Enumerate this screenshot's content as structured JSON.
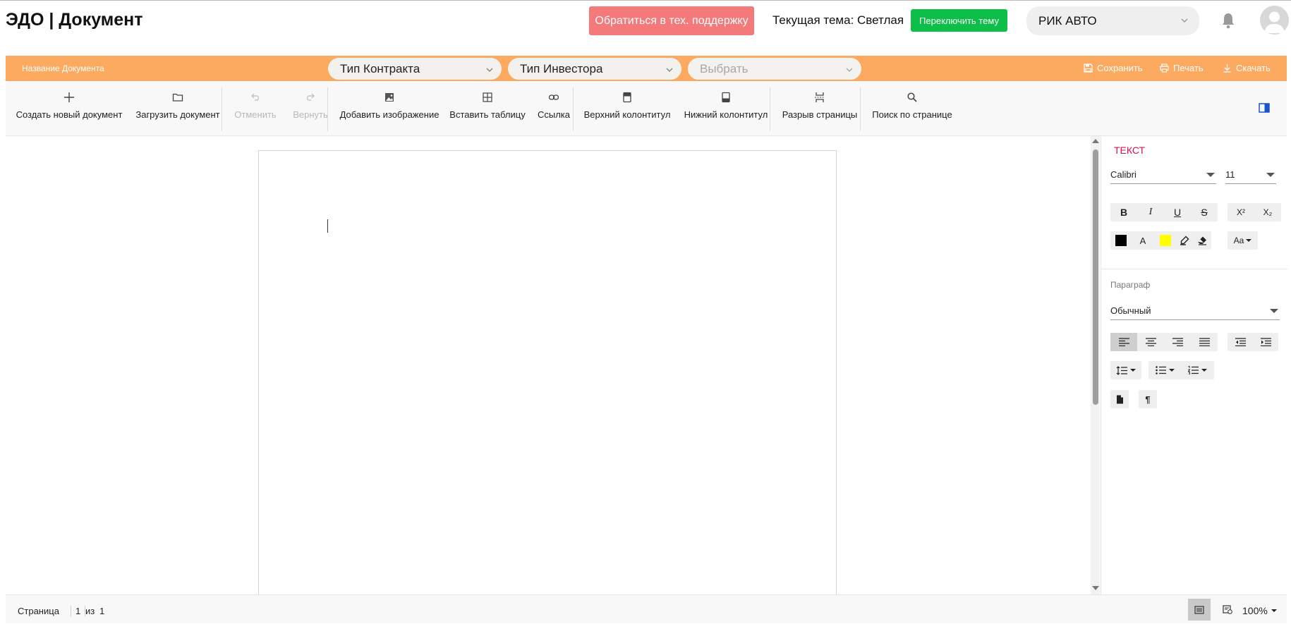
{
  "header": {
    "app_title": "ЭДО | Документ",
    "support_button": "Обратиться в тех. поддержку",
    "theme_text": "Текущая тема: Светлая",
    "switch_theme_button": "Переключить тему",
    "organization": "РИК АВТО"
  },
  "docbar": {
    "document_name": "Название Документа",
    "contract_type": "Тип Контракта",
    "investor_type": "Тип Инвестора",
    "select_placeholder": "Выбрать",
    "save": "Сохранить",
    "print": "Печать",
    "download": "Скачать"
  },
  "ribbon": {
    "new_document": "Создать новый документ",
    "upload_document": "Загрузить документ",
    "undo": "Отменить",
    "redo": "Вернуть",
    "add_image": "Добавить изображение",
    "insert_table": "Вставить таблицу",
    "link": "Ссылка",
    "header": "Верхний колонтитул",
    "footer": "Нижний колонтитул",
    "page_break": "Разрыв страницы",
    "find": "Поиск по странице"
  },
  "panel": {
    "text_section": "ТЕКСТ",
    "font_family": "Calibri",
    "font_size": "11",
    "bold": "B",
    "italic": "I",
    "underline": "U",
    "strike": "S",
    "superscript": "X²",
    "subscript": "X₂",
    "font_color_glyph": "A",
    "case_glyph": "Aa",
    "paragraph_section": "Параграф",
    "paragraph_style": "Обычный",
    "font_color": "#000000",
    "highlight_color": "#ffff00"
  },
  "status": {
    "page_label": "Страница",
    "current_page": "1",
    "of_label": "из",
    "total_pages": "1",
    "zoom": "100%"
  },
  "colors": {
    "support": "#f4797b",
    "switch_theme": "#0dbf48",
    "docbar": "#fdaa61",
    "panel_title": "#d4134f"
  }
}
